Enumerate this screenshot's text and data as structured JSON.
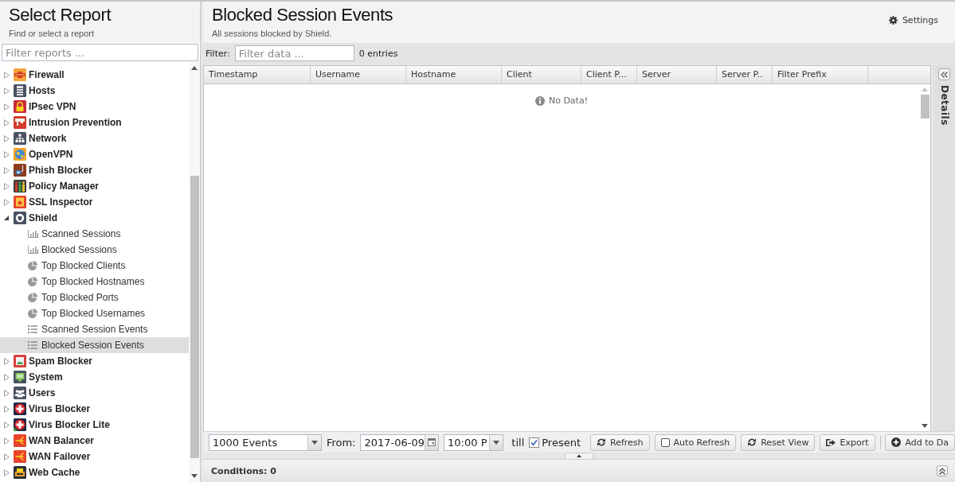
{
  "report_panel": {
    "title": "Select Report",
    "subtitle": "Find or select a report",
    "filter": {
      "placeholder": "Filter reports ..."
    }
  },
  "report_tree": [
    {
      "label": "Firewall",
      "kind": "wall",
      "expanded": false,
      "selected": false
    },
    {
      "label": "Hosts",
      "kind": "server",
      "expanded": false,
      "selected": false
    },
    {
      "label": "IPsec VPN",
      "kind": "lock",
      "expanded": false,
      "selected": false
    },
    {
      "label": "Intrusion Prevention",
      "kind": "camera",
      "expanded": false,
      "selected": false
    },
    {
      "label": "Network",
      "kind": "network",
      "expanded": false,
      "selected": false
    },
    {
      "label": "OpenVPN",
      "kind": "globe",
      "expanded": false,
      "selected": false
    },
    {
      "label": "Phish Blocker",
      "kind": "hook",
      "expanded": false,
      "selected": false
    },
    {
      "label": "Policy Manager",
      "kind": "bars",
      "expanded": false,
      "selected": false
    },
    {
      "label": "SSL Inspector",
      "kind": "certificate",
      "expanded": false,
      "selected": false
    },
    {
      "label": "Shield",
      "kind": "shield",
      "expanded": true,
      "selected": false,
      "children": [
        {
          "label": "Scanned Sessions",
          "kind": "bar",
          "selected": false
        },
        {
          "label": "Blocked Sessions",
          "kind": "bar",
          "selected": false
        },
        {
          "label": "Top Blocked Clients",
          "kind": "pie",
          "selected": false
        },
        {
          "label": "Top Blocked Hostnames",
          "kind": "pie",
          "selected": false
        },
        {
          "label": "Top Blocked Ports",
          "kind": "pie",
          "selected": false
        },
        {
          "label": "Top Blocked Usernames",
          "kind": "pie",
          "selected": false
        },
        {
          "label": "Scanned Session Events",
          "kind": "list",
          "selected": false
        },
        {
          "label": "Blocked Session Events",
          "kind": "list",
          "selected": true
        }
      ]
    },
    {
      "label": "Spam Blocker",
      "kind": "picture",
      "expanded": false,
      "selected": false
    },
    {
      "label": "System",
      "kind": "monitor",
      "expanded": false,
      "selected": false
    },
    {
      "label": "Users",
      "kind": "people",
      "expanded": false,
      "selected": false
    },
    {
      "label": "Virus Blocker",
      "kind": "cross",
      "expanded": false,
      "selected": false
    },
    {
      "label": "Virus Blocker Lite",
      "kind": "crossleaf",
      "expanded": false,
      "selected": false
    },
    {
      "label": "WAN Balancer",
      "kind": "fork",
      "expanded": false,
      "selected": false
    },
    {
      "label": "WAN Failover",
      "kind": "fork",
      "expanded": false,
      "selected": false
    },
    {
      "label": "Web Cache",
      "kind": "box",
      "expanded": false,
      "selected": false
    }
  ],
  "header": {
    "title": "Blocked Session Events",
    "subtitle": "All sessions blocked by Shield.",
    "settings_button": "Settings"
  },
  "filter_bar": {
    "label": "Filter:",
    "placeholder": "Filter data ...",
    "count": "0 entries"
  },
  "table": {
    "columns": [
      "Timestamp",
      "Username",
      "Hostname",
      "Client",
      "Client P...",
      "Server",
      "Server P..",
      "Filter Prefix"
    ],
    "empty_text": "No Data!"
  },
  "details_panel": {
    "title": "Details"
  },
  "toolbar": {
    "limit": "1000 Events",
    "from_label": "From:",
    "date": "2017-06-09",
    "time": "10:00 P",
    "till_label": "till",
    "present": {
      "label": "Present",
      "checked": true
    },
    "buttons": [
      {
        "label": "Refresh",
        "kind": "refresh"
      },
      {
        "label": "Auto Refresh",
        "kind": "toggle",
        "checked": false
      },
      {
        "label": "Reset View",
        "kind": "refresh"
      },
      {
        "label": "Export",
        "kind": "export"
      },
      {
        "label": "Add to Da",
        "kind": "add"
      }
    ]
  },
  "conditions_bar": {
    "label": "Conditions: 0"
  }
}
